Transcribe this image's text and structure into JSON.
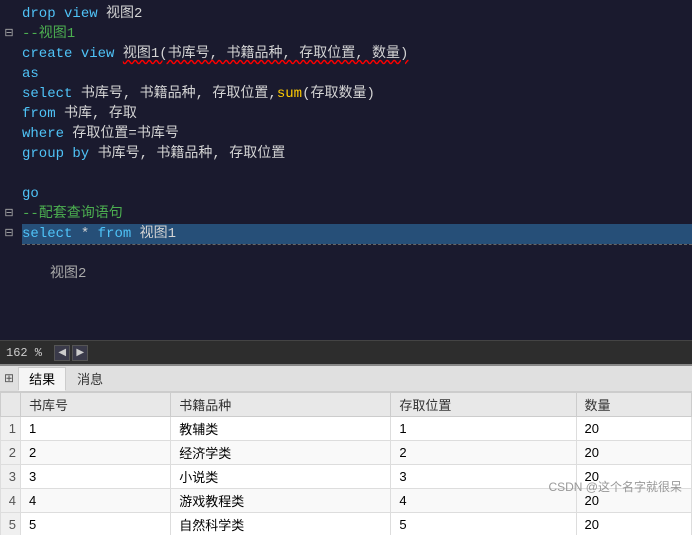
{
  "editor": {
    "lines": [
      {
        "id": 1,
        "fold": "",
        "content": "drop_view",
        "type": "drop_view"
      },
      {
        "id": 2,
        "fold": "⊟",
        "content": "create_view",
        "type": "create_view"
      },
      {
        "id": 3,
        "fold": "",
        "content": "as",
        "type": "as"
      },
      {
        "id": 4,
        "fold": "",
        "content": "select_cols",
        "type": "select_cols"
      },
      {
        "id": 5,
        "fold": "",
        "content": "from_clause",
        "type": "from_clause"
      },
      {
        "id": 6,
        "fold": "",
        "content": "where_clause",
        "type": "where_clause"
      },
      {
        "id": 7,
        "fold": "",
        "content": "group_clause",
        "type": "group_clause"
      },
      {
        "id": 8,
        "fold": "",
        "content": "blank",
        "type": "blank"
      },
      {
        "id": 9,
        "fold": "",
        "content": "go",
        "type": "go"
      },
      {
        "id": 10,
        "fold": "",
        "content": "comment",
        "type": "comment"
      },
      {
        "id": 11,
        "fold": "⊟",
        "content": "select_star",
        "type": "select_star",
        "selected": true
      },
      {
        "id": 12,
        "fold": "⊟",
        "content": "dashed",
        "type": "dashed"
      }
    ]
  },
  "status": {
    "zoom": "162 %",
    "scroll_left": "◀",
    "scroll_right": "▶"
  },
  "tabs": {
    "results_icon": "⊞",
    "items": [
      {
        "label": "结果",
        "active": true
      },
      {
        "label": "消息",
        "active": false
      }
    ]
  },
  "table": {
    "columns": [
      "书库号",
      "书籍品种",
      "存取位置",
      "数量"
    ],
    "rows": [
      {
        "row_num": "1",
        "col1": "1",
        "col2": "教辅类",
        "col3": "1",
        "col4": "20"
      },
      {
        "row_num": "2",
        "col1": "2",
        "col2": "经济学类",
        "col3": "2",
        "col4": "20"
      },
      {
        "row_num": "3",
        "col1": "3",
        "col2": "小说类",
        "col3": "3",
        "col4": "20"
      },
      {
        "row_num": "4",
        "col1": "4",
        "col2": "游戏教程类",
        "col3": "4",
        "col4": "20"
      },
      {
        "row_num": "5",
        "col1": "5",
        "col2": "自然科学类",
        "col3": "5",
        "col4": "20"
      }
    ]
  },
  "watermark": "CSDN @这个名字就很呆"
}
